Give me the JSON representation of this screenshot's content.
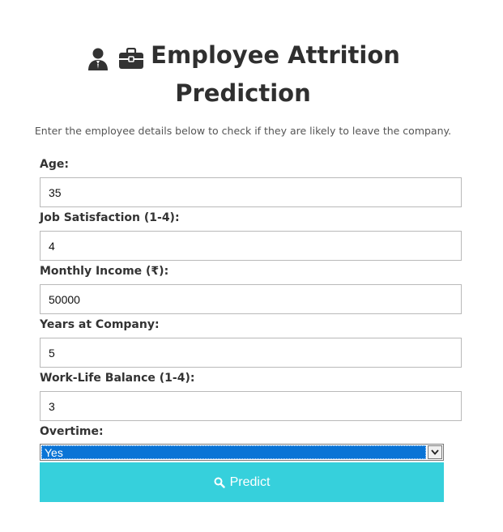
{
  "header": {
    "title": "Employee Attrition Prediction",
    "icons": [
      "user-icon",
      "briefcase-icon"
    ],
    "subtitle": "Enter the employee details below to check if they are likely to leave the company."
  },
  "form": {
    "fields": [
      {
        "label": "Age:",
        "value": "35"
      },
      {
        "label": "Job Satisfaction (1-4):",
        "value": "4"
      },
      {
        "label": "Monthly Income (₹):",
        "value": "50000"
      },
      {
        "label": "Years at Company:",
        "value": "5"
      },
      {
        "label": "Work-Life Balance (1-4):",
        "value": "3"
      }
    ],
    "overtime": {
      "label": "Overtime:",
      "selected": "Yes"
    },
    "submit": {
      "icon": "search-icon",
      "label": "Predict"
    }
  },
  "colors": {
    "button_bg": "#36d0dc",
    "select_highlight": "#0a74d6",
    "title_text": "#2f2f2f"
  }
}
